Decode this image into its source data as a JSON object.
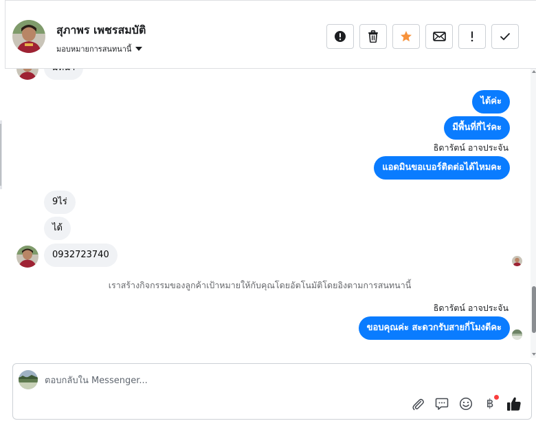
{
  "header": {
    "contact_name": "สุภาพร เพชรสมบัติ",
    "assign_label": "มอบหมายการสนทนานี้",
    "actions": [
      {
        "name": "spam-button",
        "icon": "exclamation-circle-icon"
      },
      {
        "name": "delete-button",
        "icon": "trash-icon"
      },
      {
        "name": "star-button",
        "icon": "star-icon",
        "color": "#f7923b"
      },
      {
        "name": "mark-unread-button",
        "icon": "envelope-icon"
      },
      {
        "name": "follow-up-button",
        "icon": "exclamation-icon"
      },
      {
        "name": "mark-done-button",
        "icon": "checkmark-icon"
      }
    ]
  },
  "messages": {
    "partial_top": "มีที่นา",
    "out_1": "ได้ค่ะ",
    "out_2": "มีพื้นที่กี่ไร่คะ",
    "sender_1": "ธิดารัตน์ อาจประจัน",
    "out_3": "แอดมินขอเบอร์ติดต่อได้ไหมคะ",
    "in_1": "9ไร่",
    "in_2": "ได้",
    "in_3": "0932723740",
    "system_note": "เราสร้างกิจกรรมของลูกค้าเป้าหมายให้กับคุณโดยอัตโนมัติโดยอิงตามการสนทนานี้",
    "sender_2": "ธิดารัตน์ อาจประจัน",
    "out_4": "ขอบคุณค่ะ สะดวกรับสายกี่โมงดีคะ"
  },
  "composer": {
    "placeholder": "ตอบกลับใน Messenger...",
    "tools": [
      "paperclip-icon",
      "saved-reply-icon",
      "emoji-icon",
      "baht-icon",
      "thumbs-up-icon"
    ],
    "baht_glyph": "฿",
    "notification_color": "#fa3e3e"
  },
  "colors": {
    "outgoing_bubble": "#0a7cff",
    "incoming_bubble": "#f0f2f5"
  }
}
